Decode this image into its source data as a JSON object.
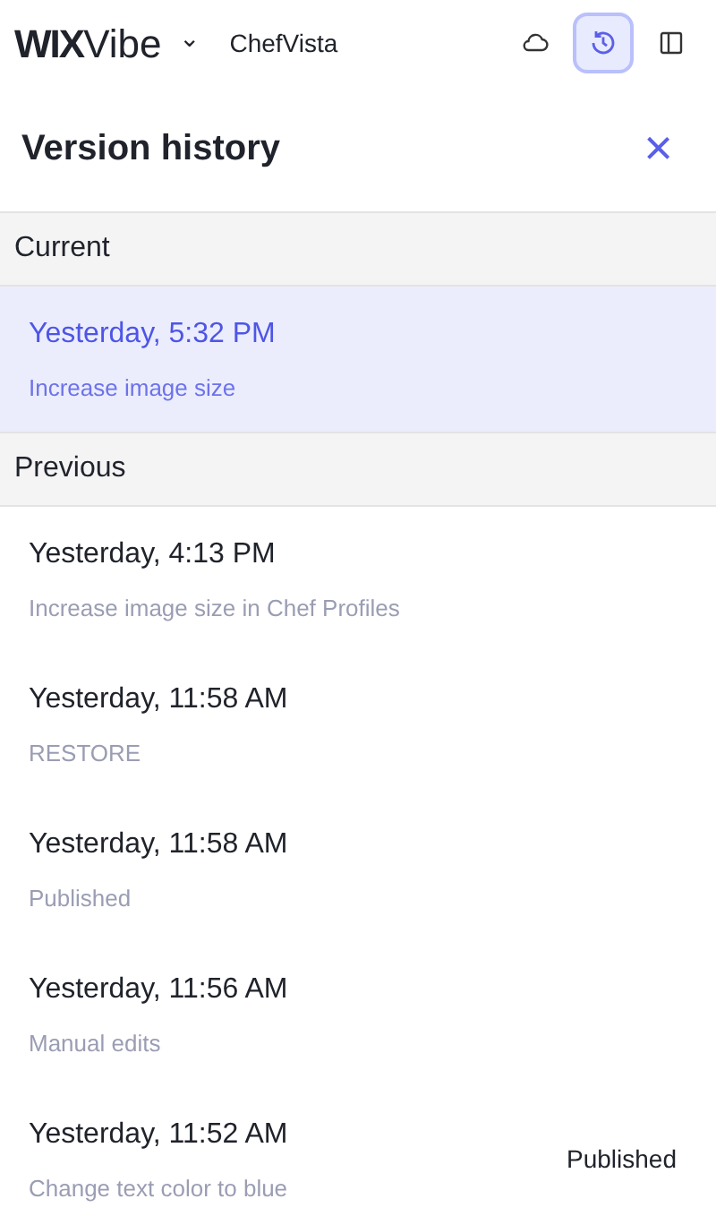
{
  "topbar": {
    "logo_bold": "WIX",
    "logo_light": "Vibe",
    "caret": "⌄",
    "project": "ChefVista",
    "buttons": [
      {
        "kind": "cloud",
        "selected": false
      },
      {
        "kind": "history",
        "selected": true
      },
      {
        "kind": "panel",
        "selected": false
      }
    ]
  },
  "panel": {
    "title": "Version history",
    "close": "×"
  },
  "sections": [
    {
      "label": "Current",
      "versions": [
        {
          "time": "Yesterday, 5:32 PM",
          "note": "Increase image size",
          "selected": true
        }
      ]
    },
    {
      "label": "Previous",
      "versions": [
        {
          "time": "Yesterday, 4:13 PM",
          "note": "Increase image size in Chef Profiles",
          "selected": false
        },
        {
          "time": "Yesterday, 11:58 AM",
          "note": "RESTORE",
          "selected": false
        },
        {
          "time": "Yesterday, 11:58 AM",
          "note": "Published",
          "selected": false
        },
        {
          "time": "Yesterday, 11:56 AM",
          "note": "Manual edits",
          "selected": false
        },
        {
          "time": "Yesterday, 11:52 AM",
          "note": "Change text color to blue",
          "tag": "Published",
          "selected": false
        }
      ]
    }
  ]
}
